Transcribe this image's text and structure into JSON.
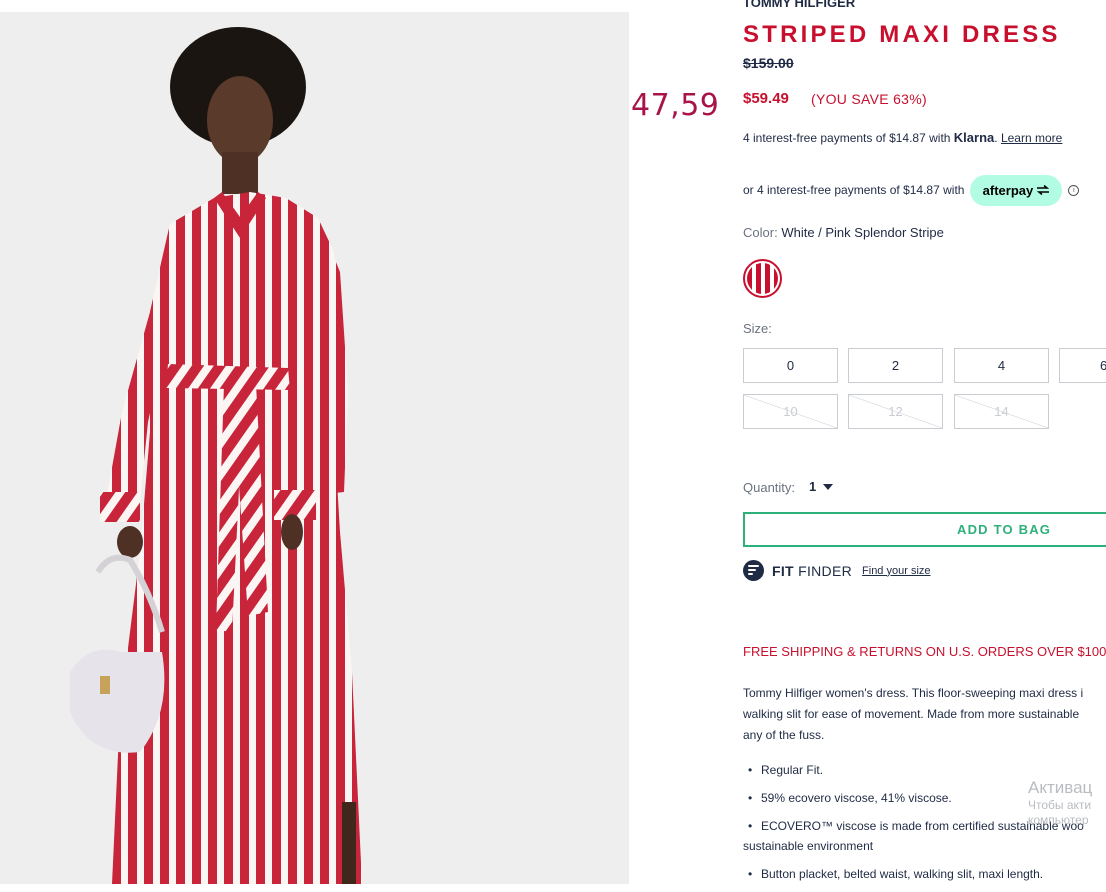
{
  "overlay_price": "47,59",
  "product": {
    "brand": "TOMMY HILFIGER",
    "title": "STRIPED MAXI DRESS",
    "price_original": "$159.00",
    "price_sale": "$59.49",
    "savings": "(YOU SAVE 63%)"
  },
  "klarna": {
    "text": "4 interest-free payments of $14.87 with",
    "brand": "Klarna",
    "link": "Learn more"
  },
  "afterpay": {
    "text": "or 4 interest-free payments of $14.87 with",
    "brand": "afterpay",
    "icon": "info-icon"
  },
  "color": {
    "label": "Color:",
    "value": "White / Pink Splendor Stripe",
    "swatch_colors": [
      "#c8102e",
      "#ffffff"
    ]
  },
  "size": {
    "label": "Size:",
    "options_available": [
      "0",
      "2",
      "4",
      "6"
    ],
    "options_unavailable": [
      "10",
      "12",
      "14"
    ]
  },
  "quantity": {
    "label": "Quantity:",
    "value": "1"
  },
  "add_to_bag": "ADD TO BAG",
  "fit_finder": {
    "fit": "FIT",
    "finder": "FINDER",
    "link": "Find your size"
  },
  "shipping": "FREE SHIPPING & RETURNS ON U.S. ORDERS OVER $100",
  "description": {
    "line1": "Tommy Hilfiger women's dress. This floor-sweeping maxi dress i",
    "line2": "walking slit for ease of movement. Made from more sustainable",
    "line3": "any of the fuss."
  },
  "bullets": [
    {
      "text": "Regular Fit."
    },
    {
      "text": "59% ecovero viscose, 41% viscose."
    },
    {
      "text": "ECOVERO™ viscose is made from certified sustainable woo",
      "cont": "sustainable environment"
    },
    {
      "text": "Button placket, belted waist, walking slit, maxi length."
    }
  ],
  "watermark": {
    "line1": "Активац",
    "line2": "Чтобы акти",
    "line3": "компьютер"
  },
  "colors": {
    "accent_red": "#c8102e",
    "overlay_red": "#a8144a",
    "add_green": "#2eb07a",
    "navy": "#1f2a44",
    "afterpay_mint": "#b2fce4"
  }
}
